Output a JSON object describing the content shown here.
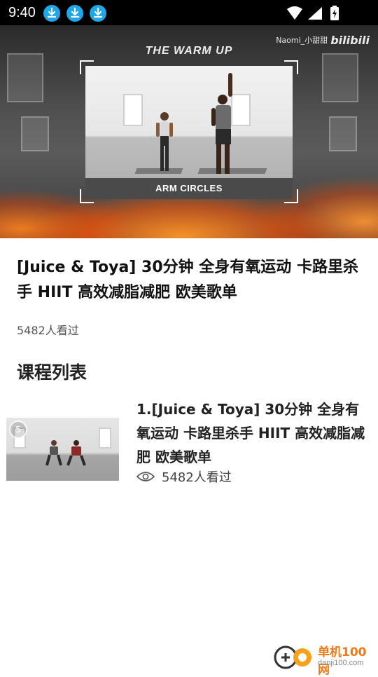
{
  "status_bar": {
    "time": "9:40",
    "download_icons": [
      "download-icon",
      "download-icon",
      "download-icon"
    ],
    "right_icons": [
      "wifi-icon",
      "signal-icon",
      "battery-charging-icon"
    ]
  },
  "video": {
    "watermark_user": "Naomi_小甜甜",
    "watermark_brand": "bilibili",
    "overlay_heading": "THE WARM UP",
    "exercise_label": "ARM CIRCLES"
  },
  "course": {
    "title": "[Juice & Toya] 30分钟 全身有氧运动 卡路里杀手 HIIT 高效减脂减肥  欧美歌单",
    "views": "5482人看过"
  },
  "section": {
    "title": "课程列表"
  },
  "lessons": [
    {
      "title": "1.[Juice & Toya] 30分钟 全身有氧运动 卡路里杀手 HIIT 高效减脂减肥  欧美歌单",
      "views": "5482人看过",
      "thumb_badge": "5"
    }
  ],
  "site_logo": {
    "name": "单机100网",
    "url": "danji100.com"
  },
  "colors": {
    "status_bar": "#000000",
    "download_badge": "#1fa7e8",
    "logo_orange": "#f07a17"
  }
}
